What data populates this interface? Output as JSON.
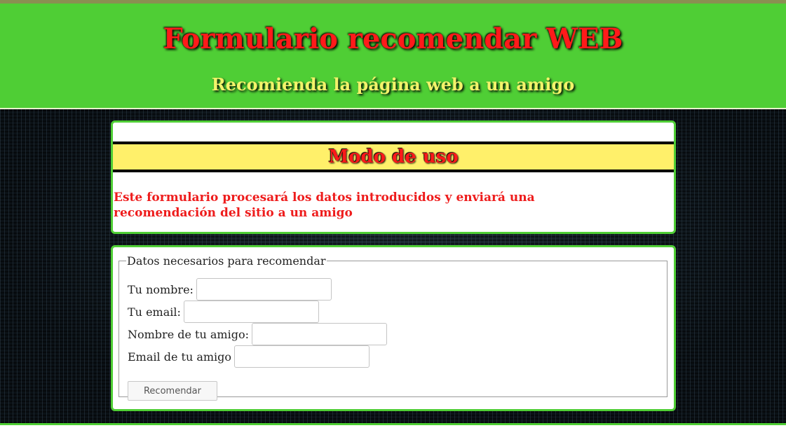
{
  "header": {
    "title": "Formulario recomendar WEB",
    "subtitle": "Recomienda la página web a un amigo"
  },
  "usage": {
    "heading": "Modo de uso",
    "text": "Este formulario procesará los datos introducidos y enviará una recomendación del sitio a un amigo"
  },
  "form": {
    "legend": "Datos necesarios para recomendar",
    "fields": [
      {
        "label": "Tu nombre:",
        "value": ""
      },
      {
        "label": "Tu email:",
        "value": ""
      },
      {
        "label": "Nombre de tu amigo:",
        "value": ""
      },
      {
        "label": "Email de tu amigo",
        "value": ""
      }
    ],
    "submit_label": "Recomendar"
  },
  "colors": {
    "header_bg": "#4fce35",
    "title_red": "#ff1a1a",
    "subtitle_yellow": "#f3f36a",
    "heading_band": "#fff06a",
    "panel_border": "#4fce35"
  }
}
